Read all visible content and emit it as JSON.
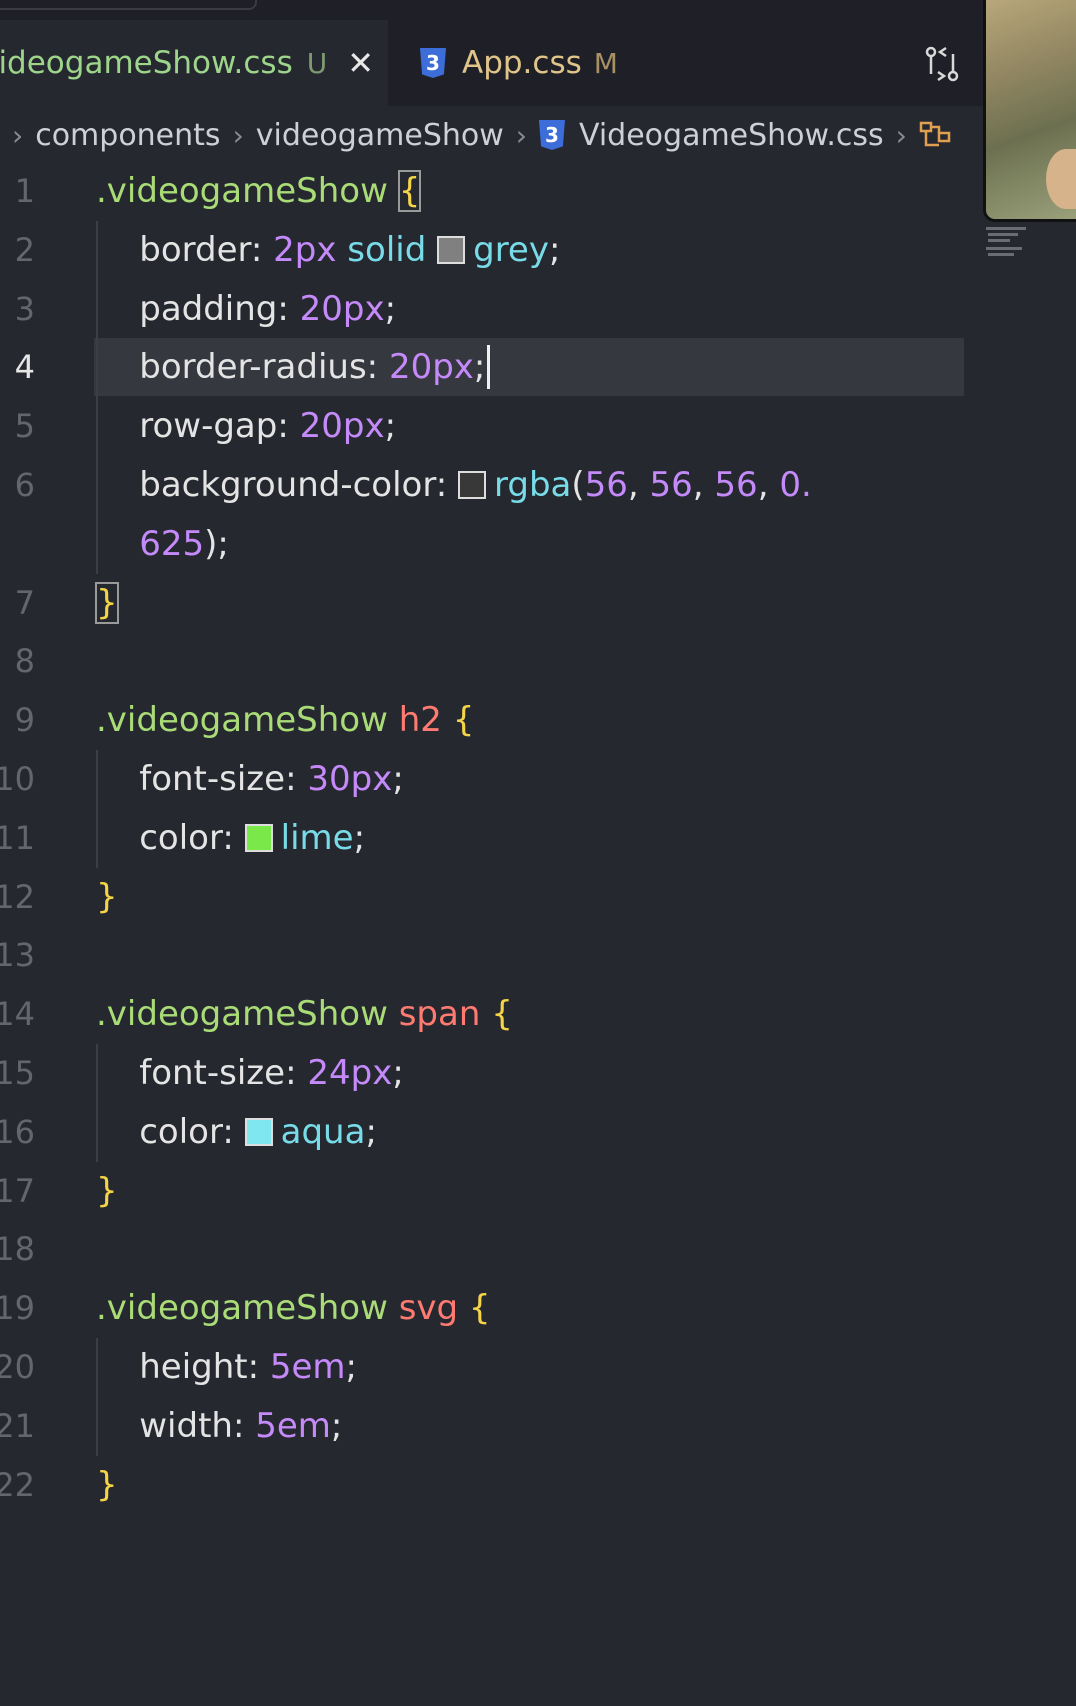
{
  "tabs": [
    {
      "name": "/ideogameShow.css",
      "badge": "U",
      "close": "✕",
      "active": true
    },
    {
      "name": "App.css",
      "badge": "M",
      "icon": "3",
      "active": false
    }
  ],
  "breadcrumb": {
    "items": [
      "components",
      "videogameShow",
      "VideogameShow.css"
    ],
    "css_icon": "3"
  },
  "editor": {
    "active_line": "4",
    "lines": [
      {
        "n": "1",
        "tokens": [
          {
            "t": ".videogameShow ",
            "c": "sel"
          },
          {
            "t": "{",
            "c": "brace box"
          }
        ]
      },
      {
        "n": "2",
        "tokens": [
          {
            "t": "    border: ",
            "c": "prop"
          },
          {
            "t": "2px ",
            "c": "num"
          },
          {
            "t": "solid ",
            "c": "kw"
          },
          {
            "t": "",
            "c": "swatch",
            "color": "#808080"
          },
          {
            "t": "grey",
            "c": "kw"
          },
          {
            "t": ";",
            "c": "punc"
          }
        ]
      },
      {
        "n": "3",
        "tokens": [
          {
            "t": "    padding: ",
            "c": "prop"
          },
          {
            "t": "20px",
            "c": "num"
          },
          {
            "t": ";",
            "c": "punc"
          }
        ]
      },
      {
        "n": "4",
        "tokens": [
          {
            "t": "    border-radius: ",
            "c": "prop"
          },
          {
            "t": "20px",
            "c": "num"
          },
          {
            "t": ";",
            "c": "punc"
          }
        ]
      },
      {
        "n": "5",
        "tokens": [
          {
            "t": "    row-gap: ",
            "c": "prop"
          },
          {
            "t": "20px",
            "c": "num"
          },
          {
            "t": ";",
            "c": "punc"
          }
        ]
      },
      {
        "n": "6",
        "tokens": [
          {
            "t": "    background-color: ",
            "c": "prop"
          },
          {
            "t": "",
            "c": "swatch",
            "color": "#383838"
          },
          {
            "t": "rgba",
            "c": "kw"
          },
          {
            "t": "(",
            "c": "punc"
          },
          {
            "t": "56",
            "c": "num"
          },
          {
            "t": ", ",
            "c": "punc"
          },
          {
            "t": "56",
            "c": "num"
          },
          {
            "t": ", ",
            "c": "punc"
          },
          {
            "t": "56",
            "c": "num"
          },
          {
            "t": ", ",
            "c": "punc"
          },
          {
            "t": "0.",
            "c": "num"
          }
        ]
      },
      {
        "n": "",
        "tokens": [
          {
            "t": "    625",
            "c": "num"
          },
          {
            "t": ");",
            "c": "punc"
          }
        ]
      },
      {
        "n": "7",
        "tokens": [
          {
            "t": "}",
            "c": "brace box"
          }
        ]
      },
      {
        "n": "8",
        "tokens": []
      },
      {
        "n": "9",
        "tokens": [
          {
            "t": ".videogameShow ",
            "c": "sel"
          },
          {
            "t": "h2 ",
            "c": "tag"
          },
          {
            "t": "{",
            "c": "brace"
          }
        ]
      },
      {
        "n": "10",
        "tokens": [
          {
            "t": "    font-size: ",
            "c": "prop"
          },
          {
            "t": "30px",
            "c": "num"
          },
          {
            "t": ";",
            "c": "punc"
          }
        ]
      },
      {
        "n": "11",
        "tokens": [
          {
            "t": "    color: ",
            "c": "prop"
          },
          {
            "t": "",
            "c": "swatch",
            "color": "#7be84a"
          },
          {
            "t": "lime",
            "c": "kw"
          },
          {
            "t": ";",
            "c": "punc"
          }
        ]
      },
      {
        "n": "12",
        "tokens": [
          {
            "t": "}",
            "c": "brace"
          }
        ]
      },
      {
        "n": "13",
        "tokens": []
      },
      {
        "n": "14",
        "tokens": [
          {
            "t": ".videogameShow ",
            "c": "sel"
          },
          {
            "t": "span ",
            "c": "tag"
          },
          {
            "t": "{",
            "c": "brace"
          }
        ]
      },
      {
        "n": "15",
        "tokens": [
          {
            "t": "    font-size: ",
            "c": "prop"
          },
          {
            "t": "24px",
            "c": "num"
          },
          {
            "t": ";",
            "c": "punc"
          }
        ]
      },
      {
        "n": "16",
        "tokens": [
          {
            "t": "    color: ",
            "c": "prop"
          },
          {
            "t": "",
            "c": "swatch",
            "color": "#7fe7ef"
          },
          {
            "t": "aqua",
            "c": "kw"
          },
          {
            "t": ";",
            "c": "punc"
          }
        ]
      },
      {
        "n": "17",
        "tokens": [
          {
            "t": "}",
            "c": "brace"
          }
        ]
      },
      {
        "n": "18",
        "tokens": []
      },
      {
        "n": "19",
        "tokens": [
          {
            "t": ".videogameShow ",
            "c": "sel"
          },
          {
            "t": "svg ",
            "c": "tag"
          },
          {
            "t": "{",
            "c": "brace"
          }
        ]
      },
      {
        "n": "20",
        "tokens": [
          {
            "t": "    height: ",
            "c": "prop"
          },
          {
            "t": "5em",
            "c": "num"
          },
          {
            "t": ";",
            "c": "punc"
          }
        ]
      },
      {
        "n": "21",
        "tokens": [
          {
            "t": "    width: ",
            "c": "prop"
          },
          {
            "t": "5em",
            "c": "num"
          },
          {
            "t": ";",
            "c": "punc"
          }
        ]
      },
      {
        "n": "22",
        "tokens": [
          {
            "t": "}",
            "c": "brace"
          }
        ]
      }
    ]
  },
  "colors": {
    "editor_bg": "#262830",
    "tab_bg": "#1f2027",
    "selector": "#a9dc76",
    "number": "#c58af9",
    "keyword": "#78dce8",
    "brace": "#f5d547",
    "tag": "#ff7b72"
  }
}
